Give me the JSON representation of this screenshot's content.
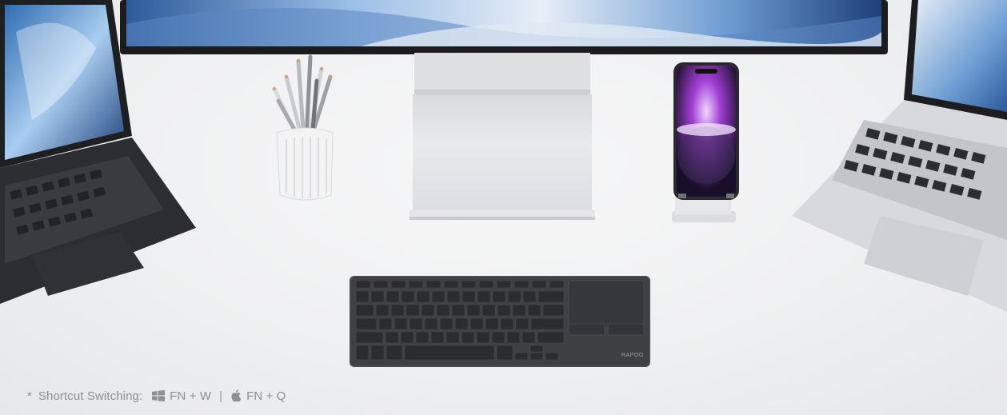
{
  "caption": {
    "asterisk": "*",
    "label": "Shortcut Switching:",
    "windows_shortcut": "FN + W",
    "separator": "|",
    "apple_shortcut": "FN + Q"
  },
  "keyboard": {
    "brand": "RAPOO"
  },
  "icons": {
    "windows": "windows-logo-icon",
    "apple": "apple-logo-icon"
  },
  "colors": {
    "background": "#f1f1f2",
    "keyboard": "#3f4042",
    "caption_text": "#8d8f93"
  }
}
